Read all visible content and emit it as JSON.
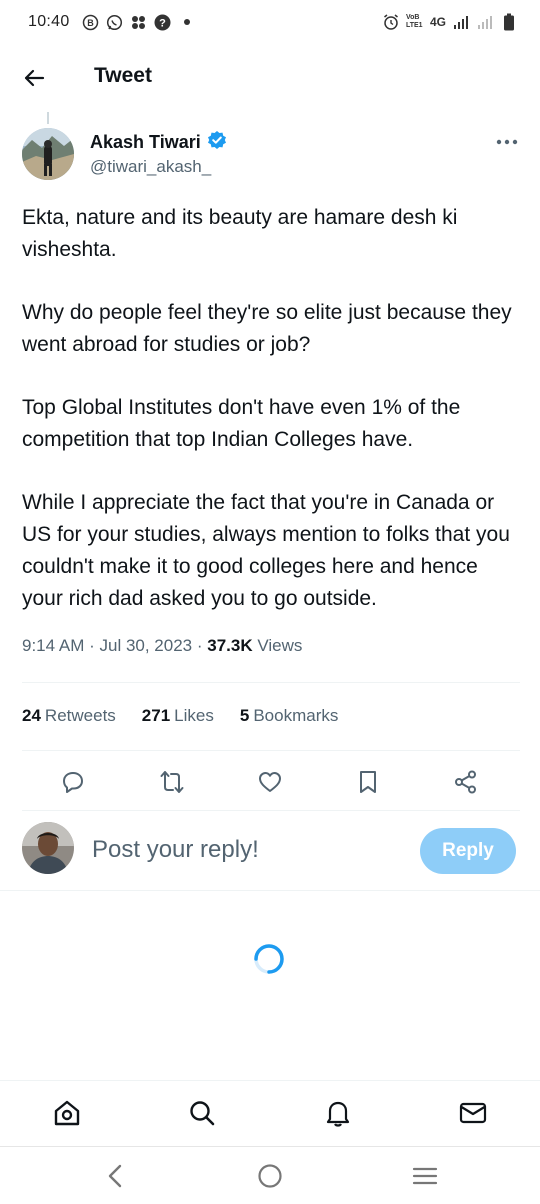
{
  "status_bar": {
    "time": "10:40",
    "network": "4G",
    "volte": "VoB LTE1",
    "icons_left": [
      "b-badge-icon",
      "whatsapp-icon",
      "pinwheel-icon",
      "help-icon",
      "dot-icon"
    ],
    "icons_right": [
      "alarm-icon",
      "volte-icon",
      "signal-icon",
      "signal-weak-icon",
      "battery-icon"
    ]
  },
  "header": {
    "title": "Tweet",
    "back_icon": "back-arrow-icon"
  },
  "tweet": {
    "author_name": "Akash Tiwari",
    "verified": true,
    "handle": "@tiwari_akash_",
    "paragraphs": [
      "Ekta, nature and its beauty are hamare desh ki visheshta.",
      "Why do people feel they're so elite just because they went abroad for studies or job?",
      "Top Global Institutes don't have even 1% of the competition that top Indian Colleges have.",
      "While I appreciate the fact that you're in Canada or US for your studies, always mention to folks that you couldn't make it to good colleges here and hence your rich dad asked you to go outside."
    ],
    "time": "9:14 AM",
    "date": "Jul 30, 2023",
    "views_count": "37.3K",
    "views_label": "Views"
  },
  "stats": {
    "retweets_count": "24",
    "retweets_label": "Retweets",
    "likes_count": "271",
    "likes_label": "Likes",
    "bookmarks_count": "5",
    "bookmarks_label": "Bookmarks"
  },
  "actions": [
    "reply-icon",
    "retweet-icon",
    "like-icon",
    "bookmark-icon",
    "share-icon"
  ],
  "reply_box": {
    "placeholder": "Post your reply!",
    "button_label": "Reply"
  },
  "bottom_nav": [
    "home-icon",
    "search-icon",
    "notifications-icon",
    "messages-icon"
  ],
  "system_nav": [
    "back-icon",
    "home-circle-icon",
    "recents-icon"
  ],
  "colors": {
    "accent": "#1d9bf0",
    "reply_button": "#8ecdf8",
    "text_primary": "#0f1419",
    "text_secondary": "#536471",
    "divider": "#eff3f4"
  }
}
